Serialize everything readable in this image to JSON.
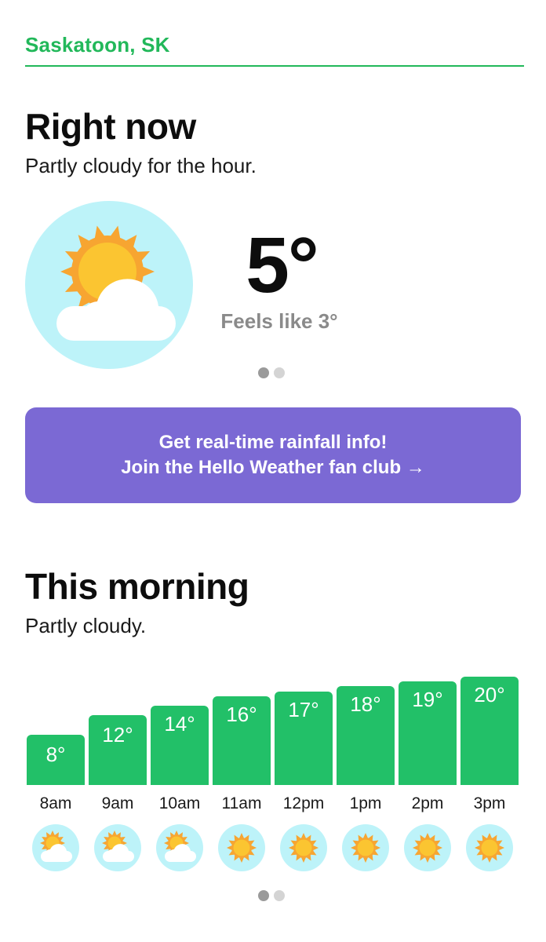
{
  "location": {
    "name": "Saskatoon, SK"
  },
  "now": {
    "heading": "Right now",
    "summary": "Partly cloudy for the hour.",
    "temperature": "5°",
    "feels_like": "Feels like 3°",
    "icon": "partly-cloudy-icon",
    "pager": {
      "count": 2,
      "active": 0
    }
  },
  "promo": {
    "line1": "Get real-time rainfall info!",
    "line2": "Join the Hello Weather fan club →"
  },
  "morning": {
    "heading": "This morning",
    "summary": "Partly cloudy.",
    "pager": {
      "count": 2,
      "active": 0
    }
  },
  "hourly": [
    {
      "time": "8am",
      "temp_label": "8°",
      "temp": 8,
      "icon": "partly-cloudy-icon"
    },
    {
      "time": "9am",
      "temp_label": "12°",
      "temp": 12,
      "icon": "partly-cloudy-icon"
    },
    {
      "time": "10am",
      "temp_label": "14°",
      "temp": 14,
      "icon": "partly-cloudy-icon"
    },
    {
      "time": "11am",
      "temp_label": "16°",
      "temp": 16,
      "icon": "sun-icon"
    },
    {
      "time": "12pm",
      "temp_label": "17°",
      "temp": 17,
      "icon": "sun-icon"
    },
    {
      "time": "1pm",
      "temp_label": "18°",
      "temp": 18,
      "icon": "sun-icon"
    },
    {
      "time": "2pm",
      "temp_label": "19°",
      "temp": 19,
      "icon": "sun-icon"
    },
    {
      "time": "3pm",
      "temp_label": "20°",
      "temp": 20,
      "icon": "sun-icon"
    }
  ],
  "colors": {
    "accent_green": "#22b85a",
    "bar_green": "#22c068",
    "promo_purple": "#7b69d4",
    "icon_bg": "#bdf3f9",
    "sun_orange": "#f7a531",
    "sun_yellow": "#fbc531"
  }
}
